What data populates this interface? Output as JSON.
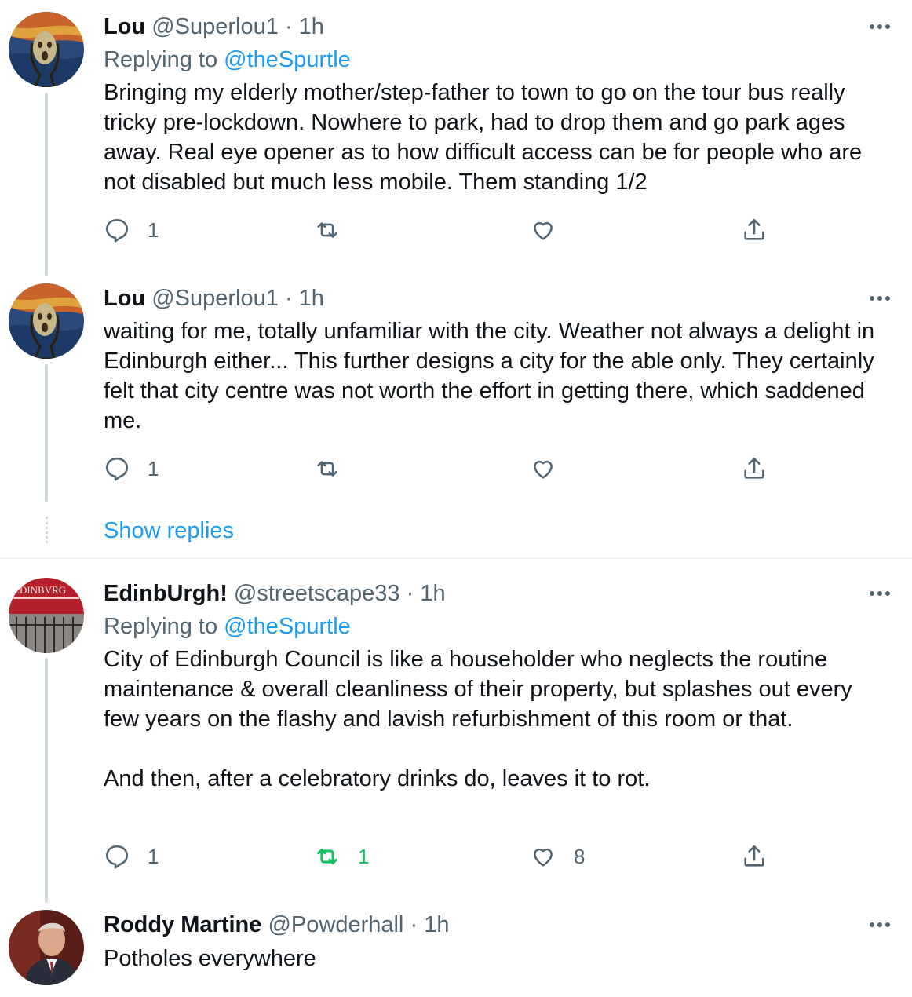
{
  "tweets": [
    {
      "name": "Lou",
      "handle": "@Superlou1",
      "sep": "·",
      "time": "1h",
      "replying_prefix": "Replying to",
      "replying_handle": "@theSpurtle",
      "text": "Bringing my elderly mother/step-father to town to go on the tour bus really tricky pre-lockdown. Nowhere to park, had to drop them and go park ages away. Real eye opener as to how difficult access can be for people who are not disabled but much less mobile. Them standing 1/2",
      "replies": "1",
      "retweets": "",
      "likes": "",
      "avatar_icon": "scream-painting-avatar"
    },
    {
      "name": "Lou",
      "handle": "@Superlou1",
      "sep": "·",
      "time": "1h",
      "text": "waiting for me, totally unfamiliar with the city. Weather not always a delight in Edinburgh either... This further designs a city for the able only. They certainly felt that city centre was not worth the effort in getting there, which saddened me.",
      "replies": "1",
      "retweets": "",
      "likes": "",
      "avatar_icon": "scream-painting-avatar"
    },
    {
      "name": "EdinbUrgh!",
      "handle": "@streetscape33",
      "sep": "·",
      "time": "1h",
      "replying_prefix": "Replying to",
      "replying_handle": "@theSpurtle",
      "text1": "City of Edinburgh Council is like a householder who neglects the routine maintenance & overall cleanliness of their property, but splashes out every few years on the flashy and lavish refurbishment of this room or that.",
      "text2": "And then, after a celebratory drinks do, leaves it to rot.",
      "replies": "1",
      "retweets": "1",
      "likes": "8",
      "avatar_icon": "edinburgh-sign-avatar",
      "avatar_text": "EDINBVRG"
    },
    {
      "name": "Roddy Martine",
      "handle": "@Powderhall",
      "sep": "·",
      "time": "1h",
      "text": "Potholes everywhere",
      "avatar_icon": "man-portrait-avatar"
    }
  ],
  "show_replies": "Show replies",
  "colors": {
    "link": "#1d9bf0",
    "muted": "#536471",
    "retweet_active": "#17bf63",
    "line": "#cfd9de"
  }
}
